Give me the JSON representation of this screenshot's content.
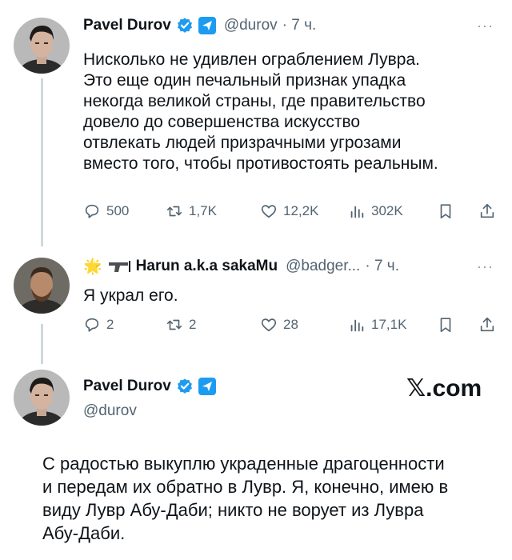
{
  "tweet1": {
    "name": "Pavel Durov",
    "handle": "@durov",
    "time": "· 7 ч.",
    "more": "···",
    "lines": [
      "Нисколько не удивлен ограблением Лувра.",
      "Это еще один печальный признак упадка",
      "некогда великой страны, где правительство",
      "довело до совершенства искусство",
      "отвлекать людей призрачными угрозами",
      "вместо того, чтобы противостоять реальным."
    ],
    "replies": "500",
    "reposts": "1,7K",
    "likes": "12,2K",
    "views": "302K"
  },
  "tweet2": {
    "emoji_prefix": "🌟",
    "name": "Harun a.k.a sakaMu",
    "handle": "@badger...",
    "time": "· 7 ч.",
    "more": "···",
    "text": "Я украл его.",
    "replies": "2",
    "reposts": "2",
    "likes": "28",
    "views": "17,1K"
  },
  "tweet3": {
    "name": "Pavel Durov",
    "handle": "@durov",
    "brand_x": "𝕏",
    "brand_com": ".com",
    "lines": [
      "С радостью выкуплю украденные драгоценности",
      "и передам их обратно в Лувр. Я, конечно, имею в",
      "виду Лувр Абу-Даби; никто не ворует из Лувра",
      "Абу-Даби."
    ]
  },
  "colors": {
    "verified": "#1d9bf0",
    "secondary_text": "#536471",
    "thread_line": "#cfd9de"
  },
  "icons": [
    "verified-badge-icon",
    "government-badge-icon",
    "reply-icon",
    "repost-icon",
    "like-icon",
    "views-icon",
    "bookmark-icon",
    "share-icon",
    "pistol-icon"
  ]
}
